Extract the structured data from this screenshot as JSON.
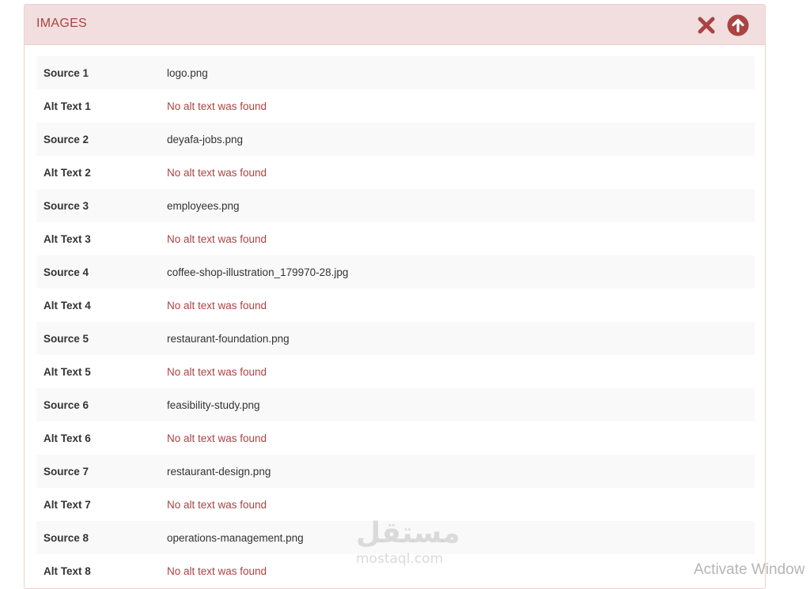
{
  "panel": {
    "title": "IMAGES",
    "close_icon": "close-icon",
    "collapse_icon": "arrow-up-circle-icon",
    "accent_color": "#a94442",
    "header_bg": "#f2dede"
  },
  "rows": [
    {
      "label": "Source 1",
      "value": "logo.png",
      "missing": false
    },
    {
      "label": "Alt Text 1",
      "value": "No alt text was found",
      "missing": true
    },
    {
      "label": "Source 2",
      "value": "deyafa-jobs.png",
      "missing": false
    },
    {
      "label": "Alt Text 2",
      "value": "No alt text was found",
      "missing": true
    },
    {
      "label": "Source 3",
      "value": "employees.png",
      "missing": false
    },
    {
      "label": "Alt Text 3",
      "value": "No alt text was found",
      "missing": true
    },
    {
      "label": "Source 4",
      "value": "coffee-shop-illustration_179970-28.jpg",
      "missing": false
    },
    {
      "label": "Alt Text 4",
      "value": "No alt text was found",
      "missing": true
    },
    {
      "label": "Source 5",
      "value": "restaurant-foundation.png",
      "missing": false
    },
    {
      "label": "Alt Text 5",
      "value": "No alt text was found",
      "missing": true
    },
    {
      "label": "Source 6",
      "value": "feasibility-study.png",
      "missing": false
    },
    {
      "label": "Alt Text 6",
      "value": "No alt text was found",
      "missing": true
    },
    {
      "label": "Source 7",
      "value": "restaurant-design.png",
      "missing": false
    },
    {
      "label": "Alt Text 7",
      "value": "No alt text was found",
      "missing": true
    },
    {
      "label": "Source 8",
      "value": "operations-management.png",
      "missing": false
    },
    {
      "label": "Alt Text 8",
      "value": "No alt text was found",
      "missing": true
    }
  ],
  "watermark": {
    "arabic": "مستقل",
    "latin": "mostaql.com"
  },
  "os_overlay": {
    "activate_text": "Activate Window"
  }
}
